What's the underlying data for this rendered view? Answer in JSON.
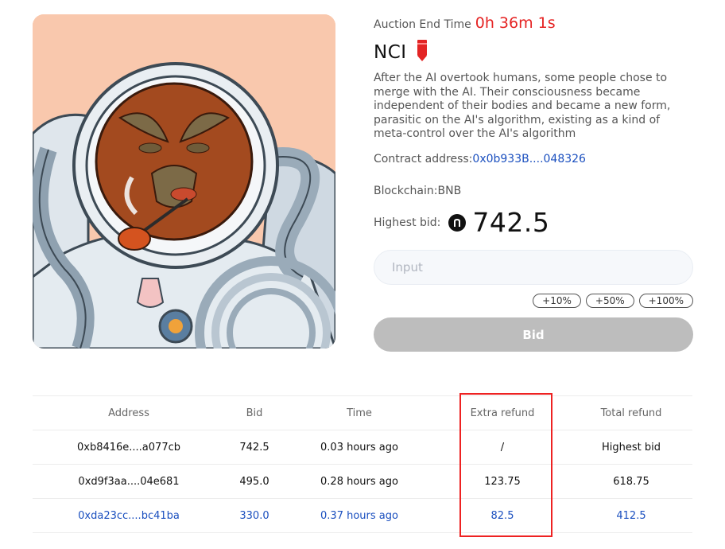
{
  "auction": {
    "end_time_label": "Auction End Time",
    "end_time_value": "0h 36m 1s",
    "title": "NCI",
    "title_icon": "pencil-icon",
    "description": "After the AI overtook humans, some people chose to merge with the AI. Their consciousness became independent of their bodies and became a new form, parasitic on the AI's algorithm, existing as a kind of meta-control over the AI's algorithm",
    "contract_label": "Contract address:",
    "contract_value": "0x0b933B....048326",
    "blockchain": "Blockchain:BNB",
    "highest_bid_label": "Highest bid:",
    "currency_icon": "coin-icon",
    "highest_bid_value": "742.5"
  },
  "bid_form": {
    "placeholder": "Input",
    "increments": [
      "+10%",
      "+50%",
      "+100%"
    ],
    "submit_label": "Bid"
  },
  "bids_table": {
    "headers": [
      "Address",
      "Bid",
      "Time",
      "Extra refund",
      "Total refund"
    ],
    "rows": [
      [
        "0xb8416e....a077cb",
        "742.5",
        "0.03 hours ago",
        "/",
        "Highest bid"
      ],
      [
        "0xd9f3aa....04e681",
        "495.0",
        "0.28 hours ago",
        "123.75",
        "618.75"
      ],
      [
        "0xda23cc....bc41ba",
        "330.0",
        "0.37 hours ago",
        "82.5",
        "412.5"
      ]
    ]
  },
  "colors": {
    "timer": "#e52323",
    "link": "#1a4fbf",
    "bid_button": "#bdbdbd",
    "highlight_box": "#ee2222",
    "art_background": "#f9c8ad"
  }
}
